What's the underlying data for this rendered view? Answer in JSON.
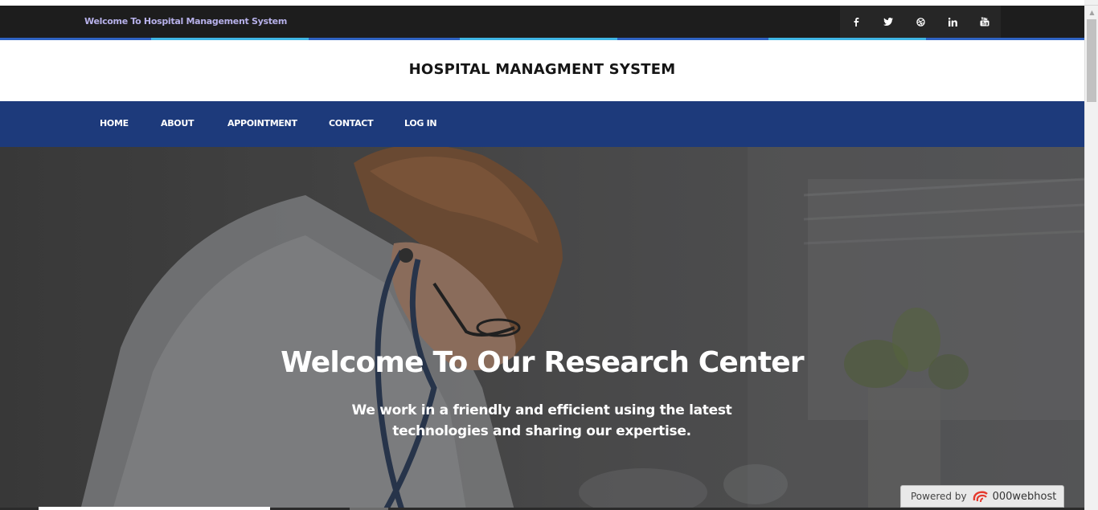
{
  "topbar": {
    "welcome_text": "Welcome To Hospital Management System",
    "social": [
      {
        "icon": "facebook-icon",
        "glyph": "f"
      },
      {
        "icon": "twitter-icon",
        "glyph": ""
      },
      {
        "icon": "dribbble-icon",
        "glyph": ""
      },
      {
        "icon": "linkedin-icon",
        "glyph": "in"
      },
      {
        "icon": "youtube-icon",
        "glyph": ""
      }
    ]
  },
  "header": {
    "title": "HOSPITAL MANAGMENT SYSTEM"
  },
  "nav": {
    "items": [
      {
        "label": "HOME"
      },
      {
        "label": "ABOUT"
      },
      {
        "label": "APPOINTMENT"
      },
      {
        "label": "CONTACT"
      },
      {
        "label": "LOG IN"
      }
    ]
  },
  "hero": {
    "title": "Welcome To Our Research Center",
    "subtitle": "We work in a friendly and efficient using the latest technologies and sharing our expertise."
  },
  "powered_by": {
    "label": "Powered by",
    "brand": "000webhost"
  },
  "colors": {
    "topbar_bg": "#1d1d1d",
    "nav_bg": "#1d3a7b",
    "welcome_text": "#b7b1ea",
    "stripe": [
      "#1d3a7b",
      "#3fb6e5"
    ]
  }
}
